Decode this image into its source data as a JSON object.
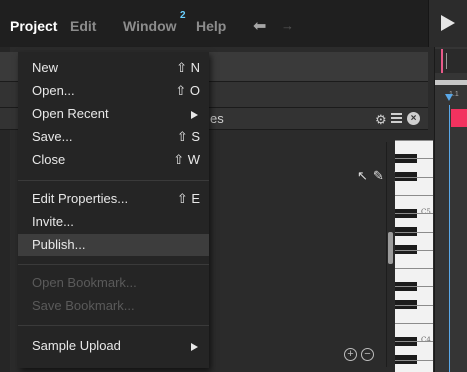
{
  "menubar": {
    "items": [
      {
        "label": "Project",
        "active": true
      },
      {
        "label": "Edit",
        "active": false
      },
      {
        "label": "Window",
        "active": false,
        "badge": "2"
      },
      {
        "label": "Help",
        "active": false
      }
    ]
  },
  "workspace": {
    "row3_text": "es",
    "piano_labels": [
      "C5",
      "C4"
    ]
  },
  "project_menu": {
    "items": [
      {
        "label": "New",
        "shortcut": "⇧ N",
        "enabled": true
      },
      {
        "label": "Open...",
        "shortcut": "⇧ O",
        "enabled": true
      },
      {
        "label": "Open Recent",
        "submenu": true,
        "enabled": true
      },
      {
        "label": "Save...",
        "shortcut": "⇧ S",
        "enabled": true
      },
      {
        "label": "Close",
        "shortcut": "⇧ W",
        "enabled": true
      },
      {
        "label": "Edit Properties...",
        "shortcut": "⇧ E",
        "enabled": true
      },
      {
        "label": "Invite...",
        "enabled": true
      },
      {
        "label": "Publish...",
        "enabled": true,
        "highlighted": true
      },
      {
        "label": "Open Bookmark...",
        "enabled": false
      },
      {
        "label": "Save Bookmark...",
        "enabled": false
      },
      {
        "label": "Sample Upload",
        "submenu": true,
        "enabled": true
      }
    ]
  },
  "colors": {
    "accent_pink": "#f2325f",
    "playhead_blue": "#5aa8e8",
    "badge_blue": "#6ad0ff"
  },
  "icons": [
    "undo-icon",
    "redo-icon",
    "play-icon",
    "stopwatch-icon",
    "pointer-icon",
    "pencil-icon",
    "select-icon",
    "hand-icon",
    "gear-icon",
    "list-icon",
    "close-circle-icon",
    "zoom-in-icon",
    "zoom-out-icon",
    "submenu-arrow-icon"
  ]
}
